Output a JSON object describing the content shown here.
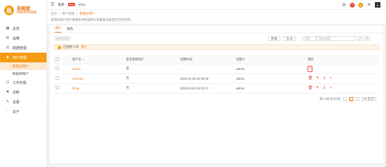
{
  "brand": {
    "logo_text": "易",
    "name": "易鲸捷",
    "sub": "数据库管理器"
  },
  "sidebar": {
    "items": [
      {
        "label": "总览",
        "icon": "grid-icon",
        "glyph": "▦",
        "chevron": ""
      },
      {
        "label": "运维",
        "icon": "wrench-icon",
        "glyph": "⚙",
        "chevron": "›"
      },
      {
        "label": "数据管理",
        "icon": "database-icon",
        "glyph": "☰",
        "chevron": "›"
      },
      {
        "label": "用户管理",
        "icon": "user-icon",
        "glyph": "♟",
        "chevron": "⌄"
      }
    ],
    "sub_items": [
      {
        "label": "管理员用户"
      },
      {
        "label": "数据库用户"
      }
    ],
    "items_after": [
      {
        "label": "工作负载",
        "icon": "tasks-icon",
        "glyph": "☷",
        "chevron": "›"
      },
      {
        "label": "诊断",
        "icon": "stethoscope-icon",
        "glyph": "✚",
        "chevron": "›"
      },
      {
        "label": "设置",
        "icon": "settings-icon",
        "glyph": "✎",
        "chevron": "›"
      },
      {
        "label": "关于",
        "icon": "about-icon",
        "glyph": "◌",
        "chevron": ""
      }
    ]
  },
  "topbar": {
    "label": "集群",
    "env_badge": "Pro",
    "env_name": "ahp1",
    "avatar": "A"
  },
  "breadcrumb": {
    "items": [
      "首页",
      "用户管理",
      "管理员用户"
    ],
    "sep": "/"
  },
  "page_desc": "管理员用户用于管理本单机提供以及集群功能是否可用可用。",
  "tabs": [
    "用户",
    "角色"
  ],
  "toolbar": {
    "new_btn": "新建管理员",
    "refresh": "刷 新",
    "import": "导 出",
    "search_label": "用名",
    "search_placeholder": "用名/搜索",
    "sq1": "⤢",
    "sq2": "⟳"
  },
  "selected_bar": {
    "text": "已选择 0 项",
    "clear": "清空"
  },
  "table": {
    "headers": [
      "用户名",
      "是否系统用户",
      "创建时间",
      "创建人",
      "操作"
    ],
    "rows": [
      {
        "name": "admin",
        "system": "是",
        "time": "-",
        "creator": "admin",
        "ops": "single"
      },
      {
        "name": "yanfeng",
        "system": "否",
        "time": "2022-12-30 22:30:28",
        "creator": "admin",
        "ops": "full"
      },
      {
        "name": "lihuai",
        "system": "否",
        "time": "2023-01-04 15:42:17",
        "creator": "admin",
        "ops": "full"
      }
    ]
  },
  "pagination": {
    "total": "第1-3条/总共3条",
    "prev": "‹",
    "current": "1",
    "next": "›",
    "size": "10 条/页"
  },
  "colors": {
    "accent": "#f39c12",
    "accent_text": "#e67e22",
    "danger": "#e74c3c"
  }
}
